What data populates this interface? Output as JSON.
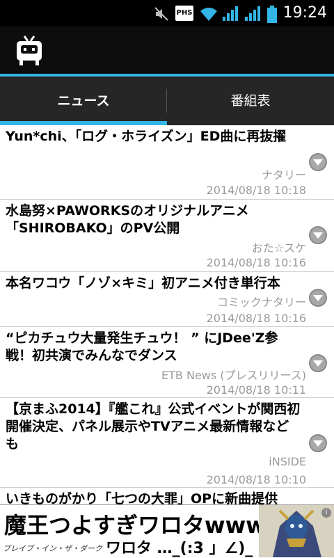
{
  "status_bar": {
    "time": "19:24",
    "icons": [
      "mute-icon",
      "phs-badge",
      "wifi-icon",
      "signal-icon",
      "signal-icon",
      "battery-icon"
    ],
    "phs_label": "PHS"
  },
  "app": {
    "icon": "tv-icon",
    "accent_color": "#33b5e5"
  },
  "tabs": [
    {
      "label": "ニュース",
      "selected": true
    },
    {
      "label": "番組表",
      "selected": false
    }
  ],
  "news": [
    {
      "title": "Yun*chi、「ログ・ホライズン」ED曲に再抜擢",
      "source": "ナタリー",
      "date": "2014/08/18 10:18"
    },
    {
      "title": "水島努×PAWORKSのオリジナルアニメ「SHIROBAKO」のPV公開",
      "source": "おた☆スケ",
      "date": "2014/08/18 10:16"
    },
    {
      "title": "本名ワコウ「ノゾ×キミ」初アニメ付き単行本",
      "source": "コミックナタリー",
      "date": "2014/08/18 10:16"
    },
    {
      "title": "“ピカチュウ大量発生チュウ！ ” にJDee'Z参戦！初共演でみんなでダンス",
      "source": "ETB News (プレスリリース)",
      "date": "2014/08/18 10:11"
    },
    {
      "title": "【京まふ2014】『艦これ』公式イベントが関西初開催決定、パネル展示やTVアニメ最新情報なども",
      "source": "iNSIDE",
      "date": "2014/08/18 10:10"
    },
    {
      "title": "いきものがかり「七つの大罪」OPに新曲提供",
      "source": "",
      "date": ""
    }
  ],
  "ad": {
    "headline": "魔王つよすぎワロタwww",
    "subtitle": "ブレイブ・イン・ザ・ダーク",
    "tagline": "ワロタ …_(:3 」∠)_",
    "info": "i"
  }
}
